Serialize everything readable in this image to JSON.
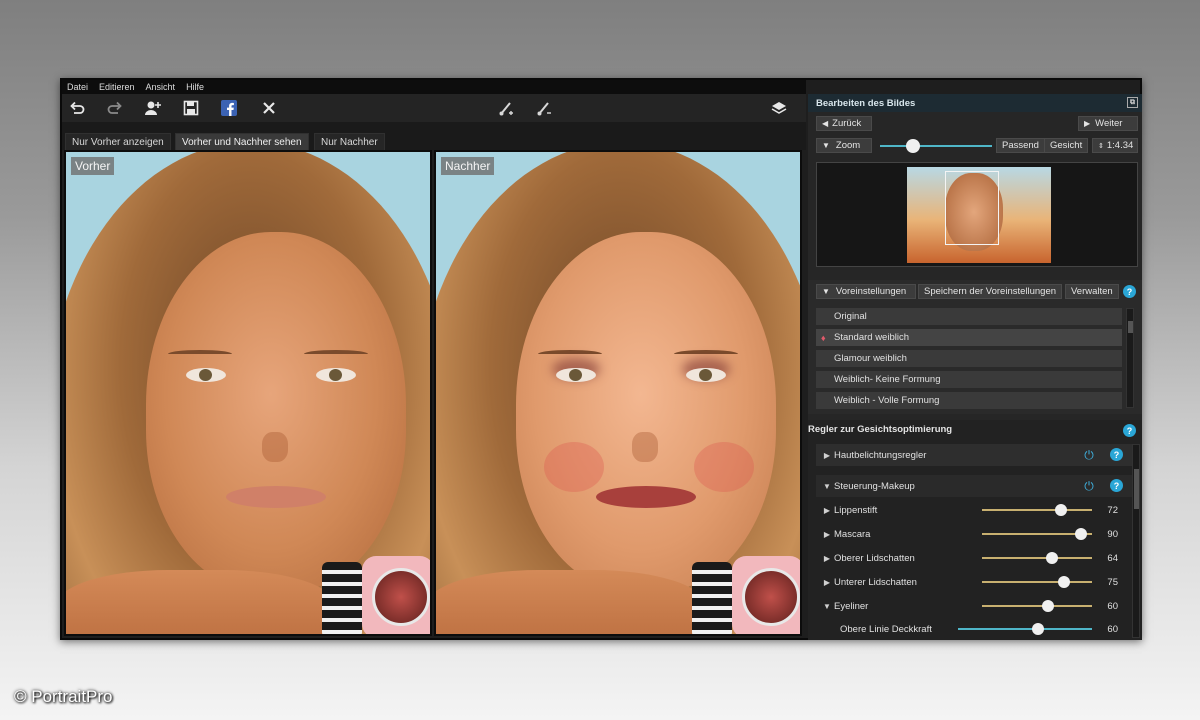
{
  "menu": [
    "Datei",
    "Editieren",
    "Ansicht",
    "Hilfe"
  ],
  "toolbar": {
    "icons": [
      "undo-icon",
      "redo-icon",
      "add-person-icon",
      "save-icon",
      "facebook-icon",
      "close-icon",
      "brush-plus-icon",
      "brush-minus-icon",
      "layers-icon"
    ]
  },
  "tabs": [
    "Nur Vorher anzeigen",
    "Vorher und Nachher sehen",
    "Nur Nachher"
  ],
  "active_tab_index": 1,
  "photos": {
    "before_label": "Vorher",
    "after_label": "Nachher"
  },
  "edit_panel": {
    "title": "Bearbeiten des Bildes",
    "back_label": "Zurück",
    "next_label": "Weiter",
    "zoom_label": "Zoom",
    "zoom_level": 0.35,
    "fit_label": "Passend",
    "face_label": "Gesicht",
    "ratio_label": "1:4.34"
  },
  "presets": {
    "header_label": "Voreinstellungen",
    "save_label": "Speichern der Voreinstellungen",
    "manage_label": "Verwalten",
    "items": [
      "Original",
      "Standard weiblich",
      "Glamour weiblich",
      "Weiblich- Keine Formung",
      "Weiblich - Volle Formung"
    ],
    "selected_index": 1
  },
  "face_controls": {
    "title": "Regler zur Gesichtsoptimierung",
    "groups": [
      {
        "label": "Hautbelichtungsregler"
      },
      {
        "label": "Steuerung-Makeup"
      }
    ],
    "sliders": [
      {
        "label": "Lippenstift",
        "value": "72"
      },
      {
        "label": "Mascara",
        "value": "90"
      },
      {
        "label": "Oberer Lidschatten",
        "value": "64"
      },
      {
        "label": "Unterer Lidschatten",
        "value": "75"
      },
      {
        "label": "Eyeliner",
        "value": "60"
      },
      {
        "label": "Obere Linie Deckkraft",
        "value": "60"
      }
    ]
  },
  "copyright": "© PortraitPro",
  "colors": {
    "accent": "#2aa6d6",
    "slider_gold": "#c8b070",
    "panel_header": "#1d2b33"
  }
}
